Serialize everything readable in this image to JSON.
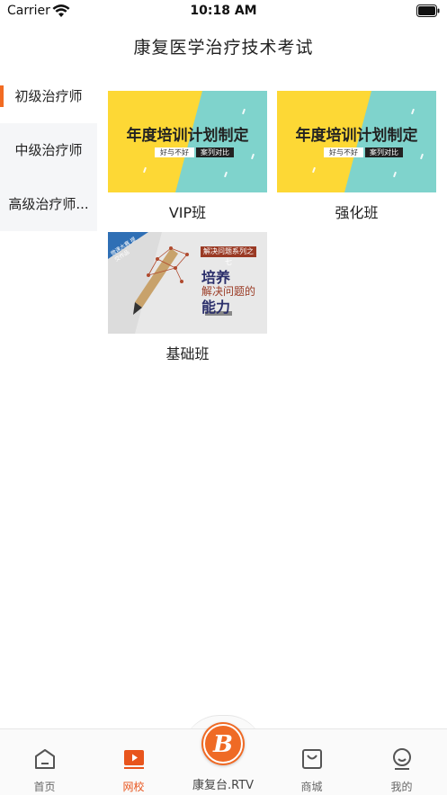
{
  "status_bar": {
    "carrier": "Carrier",
    "time": "10:18 AM"
  },
  "header": {
    "title": "康复医学治疗技术考试"
  },
  "sidebar": {
    "items": [
      {
        "label": "初级治疗师",
        "active": true
      },
      {
        "label": "中级治疗师",
        "active": false
      },
      {
        "label": "高级治疗师...",
        "active": false
      }
    ]
  },
  "courses": [
    {
      "label": "VIP班",
      "thumb_title": "年度培训计划制定",
      "thumb_tag1": "好与不好",
      "thumb_tag2": "案列对比"
    },
    {
      "label": "强化班",
      "thumb_title": "年度培训计划制定",
      "thumb_tag1": "好与不好",
      "thumb_tag2": "案列对比"
    },
    {
      "label": "基础班",
      "thumb_series": "解决问题系列之七",
      "thumb_title": "培养",
      "thumb_sub": "解决问题的",
      "thumb_sub2": "能力",
      "thumb_corner": "微课大赛 提交作品"
    }
  ],
  "tabbar": {
    "tabs": [
      {
        "label": "首页",
        "icon": "home-icon"
      },
      {
        "label": "网校",
        "icon": "video-play-icon",
        "active": true
      },
      {
        "label": "康复台.RTV",
        "icon": "rtv-logo"
      },
      {
        "label": "商城",
        "icon": "shopping-bag-icon"
      },
      {
        "label": "我的",
        "icon": "profile-icon"
      }
    ]
  },
  "colors": {
    "accent": "#f26b22",
    "yellow": "#fdd835",
    "teal": "#7fd3cc"
  }
}
